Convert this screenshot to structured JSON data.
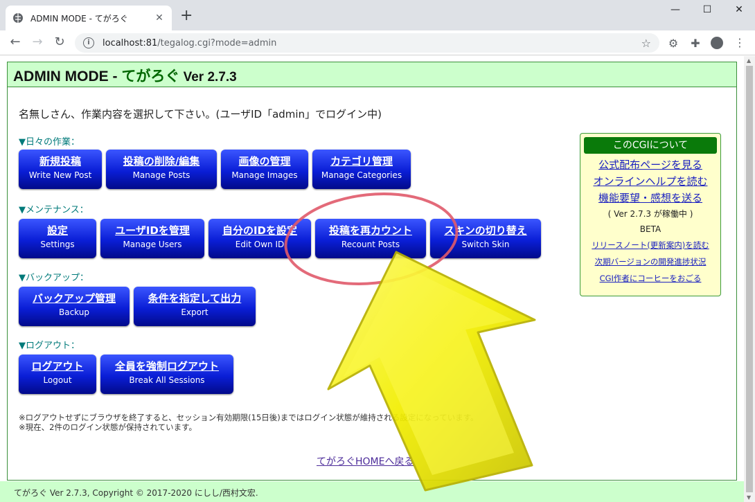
{
  "browser": {
    "tab_title": "ADMIN MODE - てがろぐ",
    "tab_close": "✕",
    "new_tab": "+",
    "url_host": "localhost:81",
    "url_path": "/tegalog.cgi?mode=admin",
    "controls": {
      "minimize": "—",
      "maximize": "☐",
      "close": "✕"
    }
  },
  "header": {
    "prefix": "ADMIN MODE - ",
    "accent": "てがろぐ",
    "version": " Ver 2.7.3"
  },
  "greeting": "名無しさん、作業内容を選択して下さい。(ユーザID「admin」でログイン中)",
  "sections": [
    {
      "label": "▼日々の作業：",
      "buttons": [
        {
          "main": "新規投稿",
          "sub": "Write New Post"
        },
        {
          "main": "投稿の削除/編集",
          "sub": "Manage Posts"
        },
        {
          "main": "画像の管理",
          "sub": "Manage Images"
        },
        {
          "main": "カテゴリ管理",
          "sub": "Manage Categories"
        }
      ]
    },
    {
      "label": "▼メンテナンス：",
      "buttons": [
        {
          "main": "設定",
          "sub": "Settings"
        },
        {
          "main": "ユーザIDを管理",
          "sub": "Manage Users"
        },
        {
          "main": "自分のIDを設定",
          "sub": "Edit Own ID"
        },
        {
          "main": "投稿を再カウント",
          "sub": "Recount Posts"
        },
        {
          "main": "スキンの切り替え",
          "sub": "Switch Skin"
        }
      ]
    },
    {
      "label": "▼バックアップ：",
      "buttons": [
        {
          "main": "バックアップ管理",
          "sub": "Backup"
        },
        {
          "main": "条件を指定して出力",
          "sub": "Export"
        }
      ]
    },
    {
      "label": "▼ログアウト：",
      "buttons": [
        {
          "main": "ログアウト",
          "sub": "Logout"
        },
        {
          "main": "全員を強制ログアウト",
          "sub": "Break All Sessions"
        }
      ]
    }
  ],
  "notes": [
    "※ログアウトせずにブラウザを終了すると、セッション有効期限(15日後)まではログイン状態が維持される設定になっています。",
    "※現在、2件のログイン状態が保持されています。"
  ],
  "home_link": "てがろぐHOMEへ戻る",
  "sidebox": {
    "heading": "このCGIについて",
    "links": [
      "公式配布ページを見る",
      "オンラインヘルプを読む",
      "機能要望・感想を送る"
    ],
    "status": "( Ver 2.7.3 が稼働中 )",
    "channel": "BETA",
    "small_links": [
      "リリースノート(更新案内)を読む",
      "次期バージョンの開発進捗状況",
      "CGI作者にコーヒーをおごる"
    ]
  },
  "footer": "てがろぐ Ver 2.7.3, Copyright © 2017-2020 にしし/西村文宏.",
  "colors": {
    "header_bg": "#ccffcc",
    "button_top": "#3b56ff",
    "button_bottom": "#020a8a",
    "annotation_circle": "#e05a6a",
    "annotation_arrow": "#f5f000"
  }
}
